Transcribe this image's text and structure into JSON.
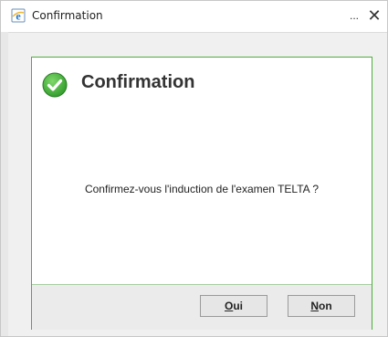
{
  "window": {
    "title": "Confirmation",
    "minimize_label": "...",
    "close_label": "✕",
    "app_icon": "internet-explorer-icon"
  },
  "dialog": {
    "title": "Confirmation",
    "icon": "check-circle-icon",
    "message": "Confirmez-vous l'induction de l'examen TELTA ?",
    "accent_color": "#4cae3c"
  },
  "buttons": {
    "yes": {
      "mnemonic": "O",
      "rest": "ui",
      "label": "Oui"
    },
    "no": {
      "mnemonic": "N",
      "rest": "on",
      "label": "Non"
    }
  }
}
